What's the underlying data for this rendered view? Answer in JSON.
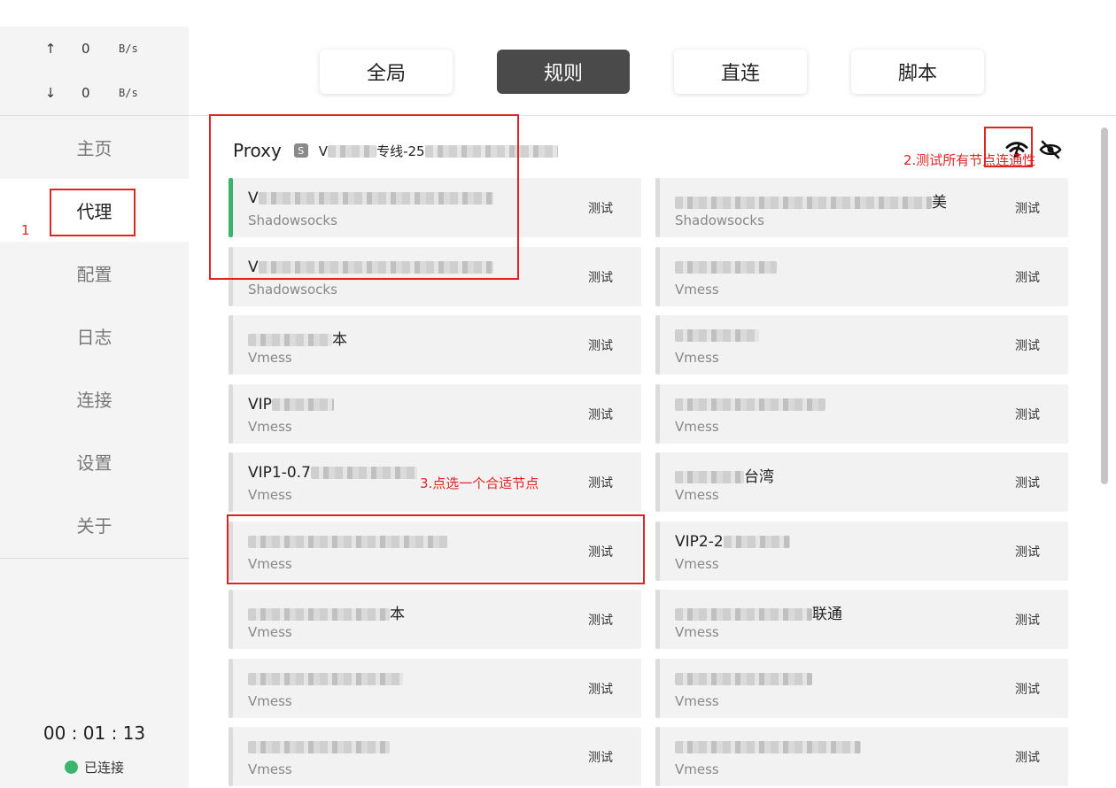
{
  "window": {
    "controls": [
      {
        "name": "pin-icon"
      },
      {
        "name": "minimize-icon"
      },
      {
        "name": "maximize-icon"
      },
      {
        "name": "close-icon"
      }
    ]
  },
  "traffic": {
    "up_arrow": "↑",
    "up_value": "0",
    "up_unit": "B/s",
    "down_arrow": "↓",
    "down_value": "0",
    "down_unit": "B/s"
  },
  "nav": {
    "items": [
      {
        "label": "主页"
      },
      {
        "label": "代理"
      },
      {
        "label": "配置"
      },
      {
        "label": "日志"
      },
      {
        "label": "连接"
      },
      {
        "label": "设置"
      },
      {
        "label": "关于"
      }
    ],
    "active_index": 1
  },
  "status": {
    "uptime": "00 : 01 : 13",
    "connection": "已连接",
    "connected_color": "#3bb46e"
  },
  "modes": {
    "items": [
      {
        "label": "全局"
      },
      {
        "label": "规则"
      },
      {
        "label": "直连"
      },
      {
        "label": "脚本"
      }
    ],
    "active_index": 1
  },
  "group": {
    "name": "Proxy",
    "tag": "S",
    "selected_prefix": "V",
    "selected_mid": "专线-25"
  },
  "proxies": {
    "test_label": "测试",
    "left": [
      {
        "prefix": "V",
        "type": "Shadowsocks",
        "selected": true
      },
      {
        "prefix": "V",
        "type": "Shadowsocks",
        "selected": false
      },
      {
        "prefix": "",
        "suffix": "本",
        "type": "Vmess",
        "selected": false
      },
      {
        "prefix": "VIP",
        "type": "Vmess",
        "selected": false
      },
      {
        "prefix": "VIP1-0.7",
        "type": "Vmess",
        "selected": false
      },
      {
        "prefix": "",
        "type": "Vmess",
        "selected": false
      },
      {
        "prefix": "",
        "suffix": "本",
        "type": "Vmess",
        "selected": false
      },
      {
        "prefix": "",
        "type": "Vmess",
        "selected": false
      },
      {
        "prefix": "",
        "type": "Vmess",
        "selected": false
      }
    ],
    "right": [
      {
        "prefix": "",
        "suffix": "美",
        "type": "Shadowsocks",
        "selected": false
      },
      {
        "prefix": "",
        "type": "Vmess",
        "selected": false
      },
      {
        "prefix": "",
        "type": "Vmess",
        "selected": false
      },
      {
        "prefix": "",
        "type": "Vmess",
        "selected": false
      },
      {
        "prefix": "",
        "suffix": "台湾",
        "type": "Vmess",
        "selected": false
      },
      {
        "prefix": "VIP2-2",
        "type": "Vmess",
        "selected": false
      },
      {
        "prefix": "",
        "suffix": "联通",
        "type": "Vmess",
        "selected": false
      },
      {
        "prefix": "",
        "type": "Vmess",
        "selected": false
      },
      {
        "prefix": "",
        "type": "Vmess",
        "selected": false
      }
    ]
  },
  "annotations": {
    "step1": "1",
    "step2": "2.测试所有节点连通性",
    "step3": "3.点选一个合适节点",
    "color": "#e02424"
  }
}
